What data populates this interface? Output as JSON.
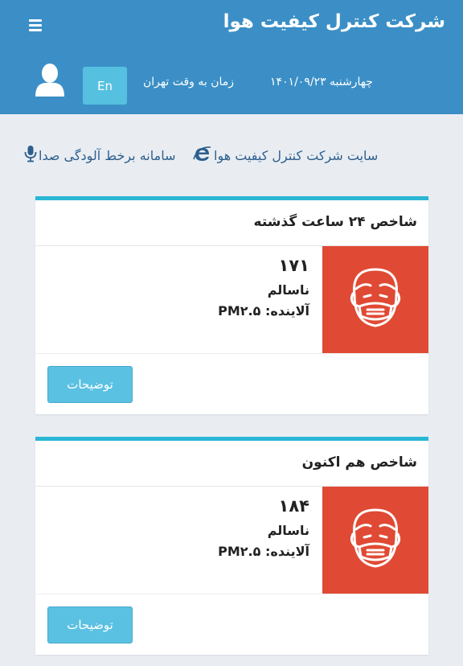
{
  "header": {
    "title": "شرکت کنترل کیفیت هوا",
    "menu_icon": "menu-icon",
    "user_icon": "user-icon",
    "lang_button": "En",
    "time_label": "زمان به وقت تهران",
    "date": "چهارشنبه ۱۴۰۱/۰۹/۲۳"
  },
  "links": {
    "site": {
      "label": "سایت شرکت کنترل کیفیت هوا",
      "icon": "internet-explorer-icon"
    },
    "noise": {
      "label": "سامانه برخط آلودگی صدا",
      "icon": "microphone-icon"
    }
  },
  "cards": [
    {
      "title": "شاخص ۲۴ ساعت گذشته",
      "value": "۱۷۱",
      "status": "ناسالم",
      "pollutant": "آلاینده: PM۲.۵",
      "status_icon": "face-mask-icon",
      "button": "توضیحات"
    },
    {
      "title": "شاخص هم اکنون",
      "value": "۱۸۴",
      "status": "ناسالم",
      "pollutant": "آلاینده: PM۲.۵",
      "status_icon": "face-mask-icon",
      "button": "توضیحات"
    }
  ],
  "colors": {
    "header": "#3b8fc6",
    "accent": "#2ab7d6",
    "unhealthy": "#e04a34",
    "button": "#5bc1e2"
  }
}
